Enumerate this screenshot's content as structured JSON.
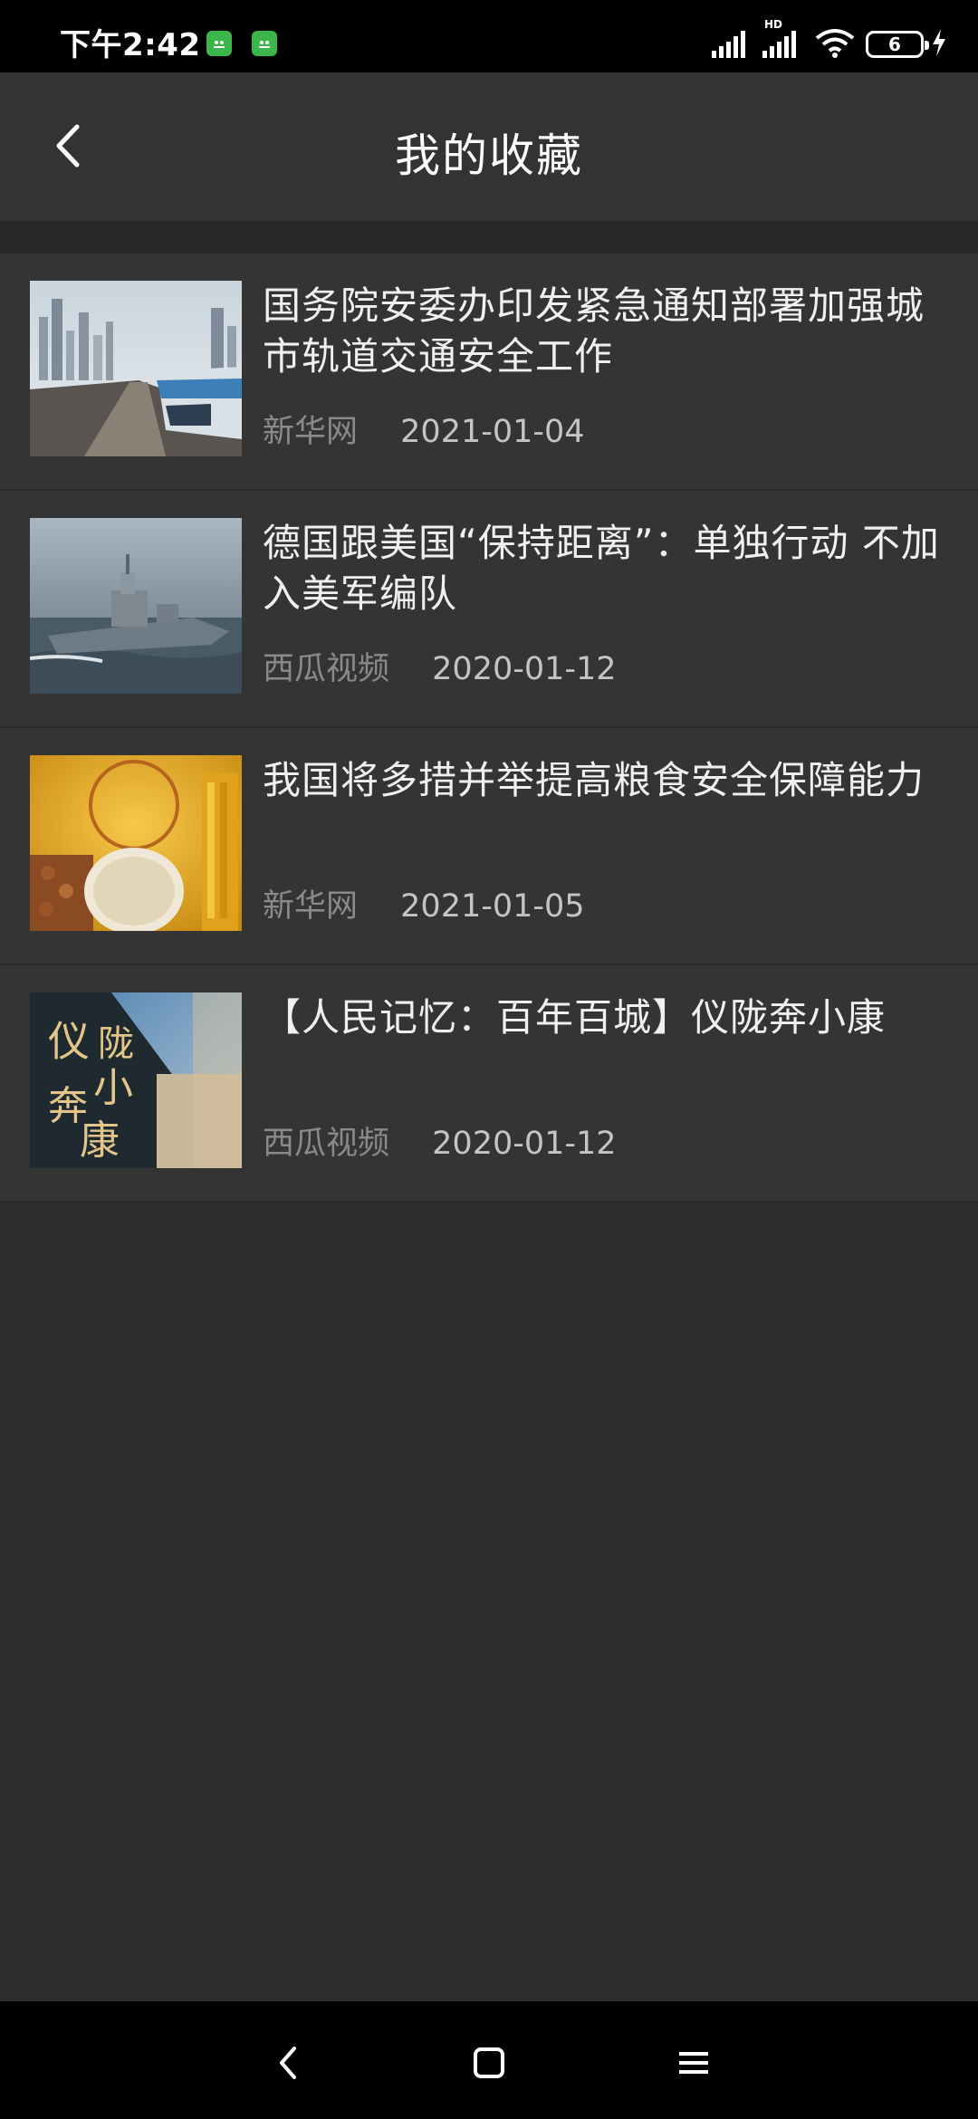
{
  "status_bar": {
    "time": "下午2:42",
    "hd": "HD",
    "battery": "6"
  },
  "header": {
    "title": "我的收藏"
  },
  "news": [
    {
      "title": "国务院安委办印发紧急通知部署加强城市轨道交通安全工作",
      "source": "新华网",
      "date": "2021-01-04",
      "thumb": "train-thumbnail"
    },
    {
      "title": "德国跟美国“保持距离”：单独行动 不加入美军编队",
      "source": "西瓜视频",
      "date": "2020-01-12",
      "thumb": "warship-thumbnail"
    },
    {
      "title": "我国将多措并举提高粮食安全保障能力",
      "source": "新华网",
      "date": "2021-01-05",
      "thumb": "grain-thumbnail"
    },
    {
      "title": "【人民记忆：百年百城】仪陇奔小康",
      "source": "西瓜视频",
      "date": "2020-01-12",
      "thumb": "city-thumbnail",
      "thumb_text": "仪陇奔小康"
    }
  ],
  "colors": {
    "background": "#2e2e2e",
    "card": "#343434",
    "title_text": "#f0f0f0",
    "source_text": "#8a8a8a",
    "date_text": "#c4c4c4",
    "badge": "#3cb64a"
  },
  "icons": {
    "back": "chevron-left-icon",
    "nav_back": "nav-back-icon",
    "nav_home": "nav-home-icon",
    "nav_menu": "nav-menu-icon"
  }
}
